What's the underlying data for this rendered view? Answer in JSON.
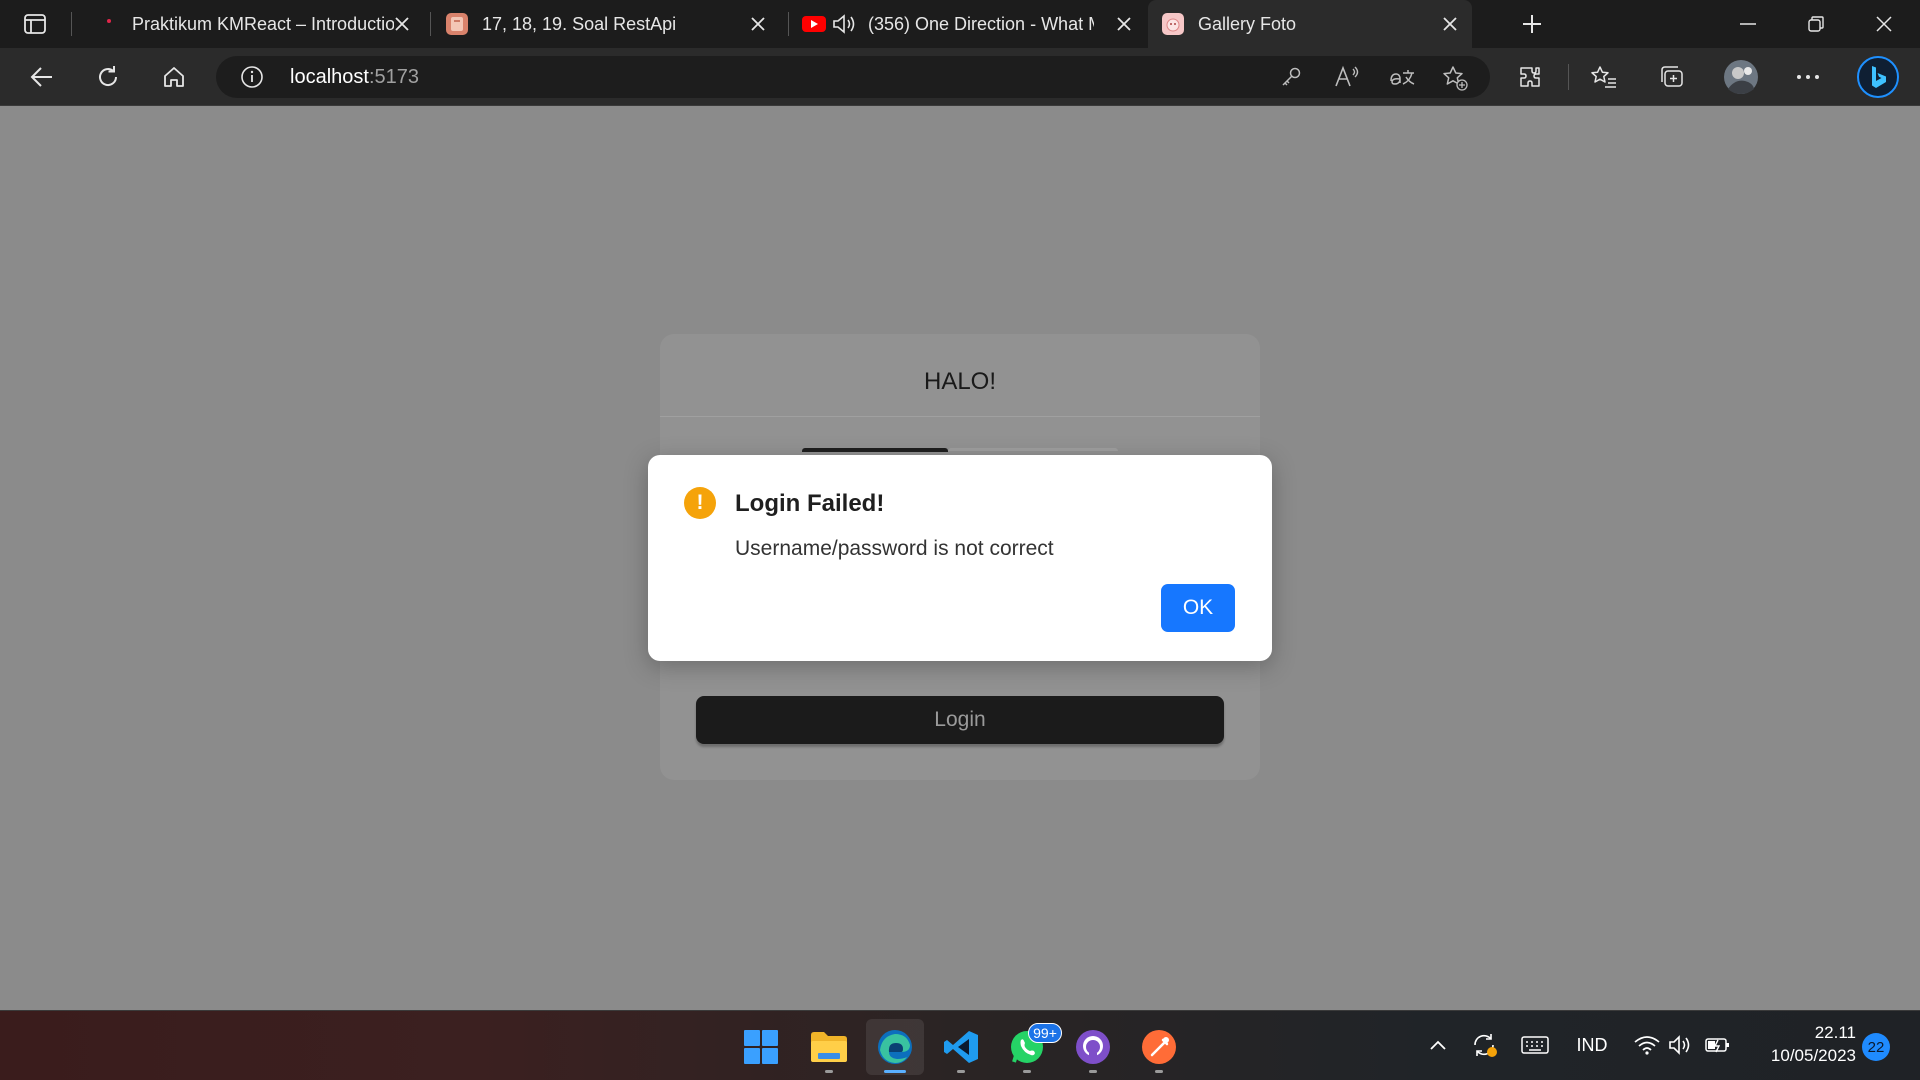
{
  "browser": {
    "tabs": [
      {
        "title": "Praktikum KMReact – Introductio",
        "active": false
      },
      {
        "title": "17, 18, 19. Soal RestApi",
        "active": false
      },
      {
        "title": "(356) One Direction - What M",
        "active": false
      },
      {
        "title": "Gallery Foto",
        "active": true
      }
    ],
    "address": {
      "host": "localhost",
      "port": ":5173"
    }
  },
  "page": {
    "card_title": "HALO!",
    "login_button": "Login"
  },
  "dialog": {
    "title": "Login Failed!",
    "message": "Username/password is not correct",
    "ok_label": "OK",
    "icon_glyph": "!",
    "icon_color": "#f5a30a",
    "accent_color": "#1677ff"
  },
  "taskbar": {
    "whatsapp_badge": "99+",
    "language": "IND",
    "time": "22.11",
    "date": "10/05/2023",
    "notification_count": "22"
  }
}
